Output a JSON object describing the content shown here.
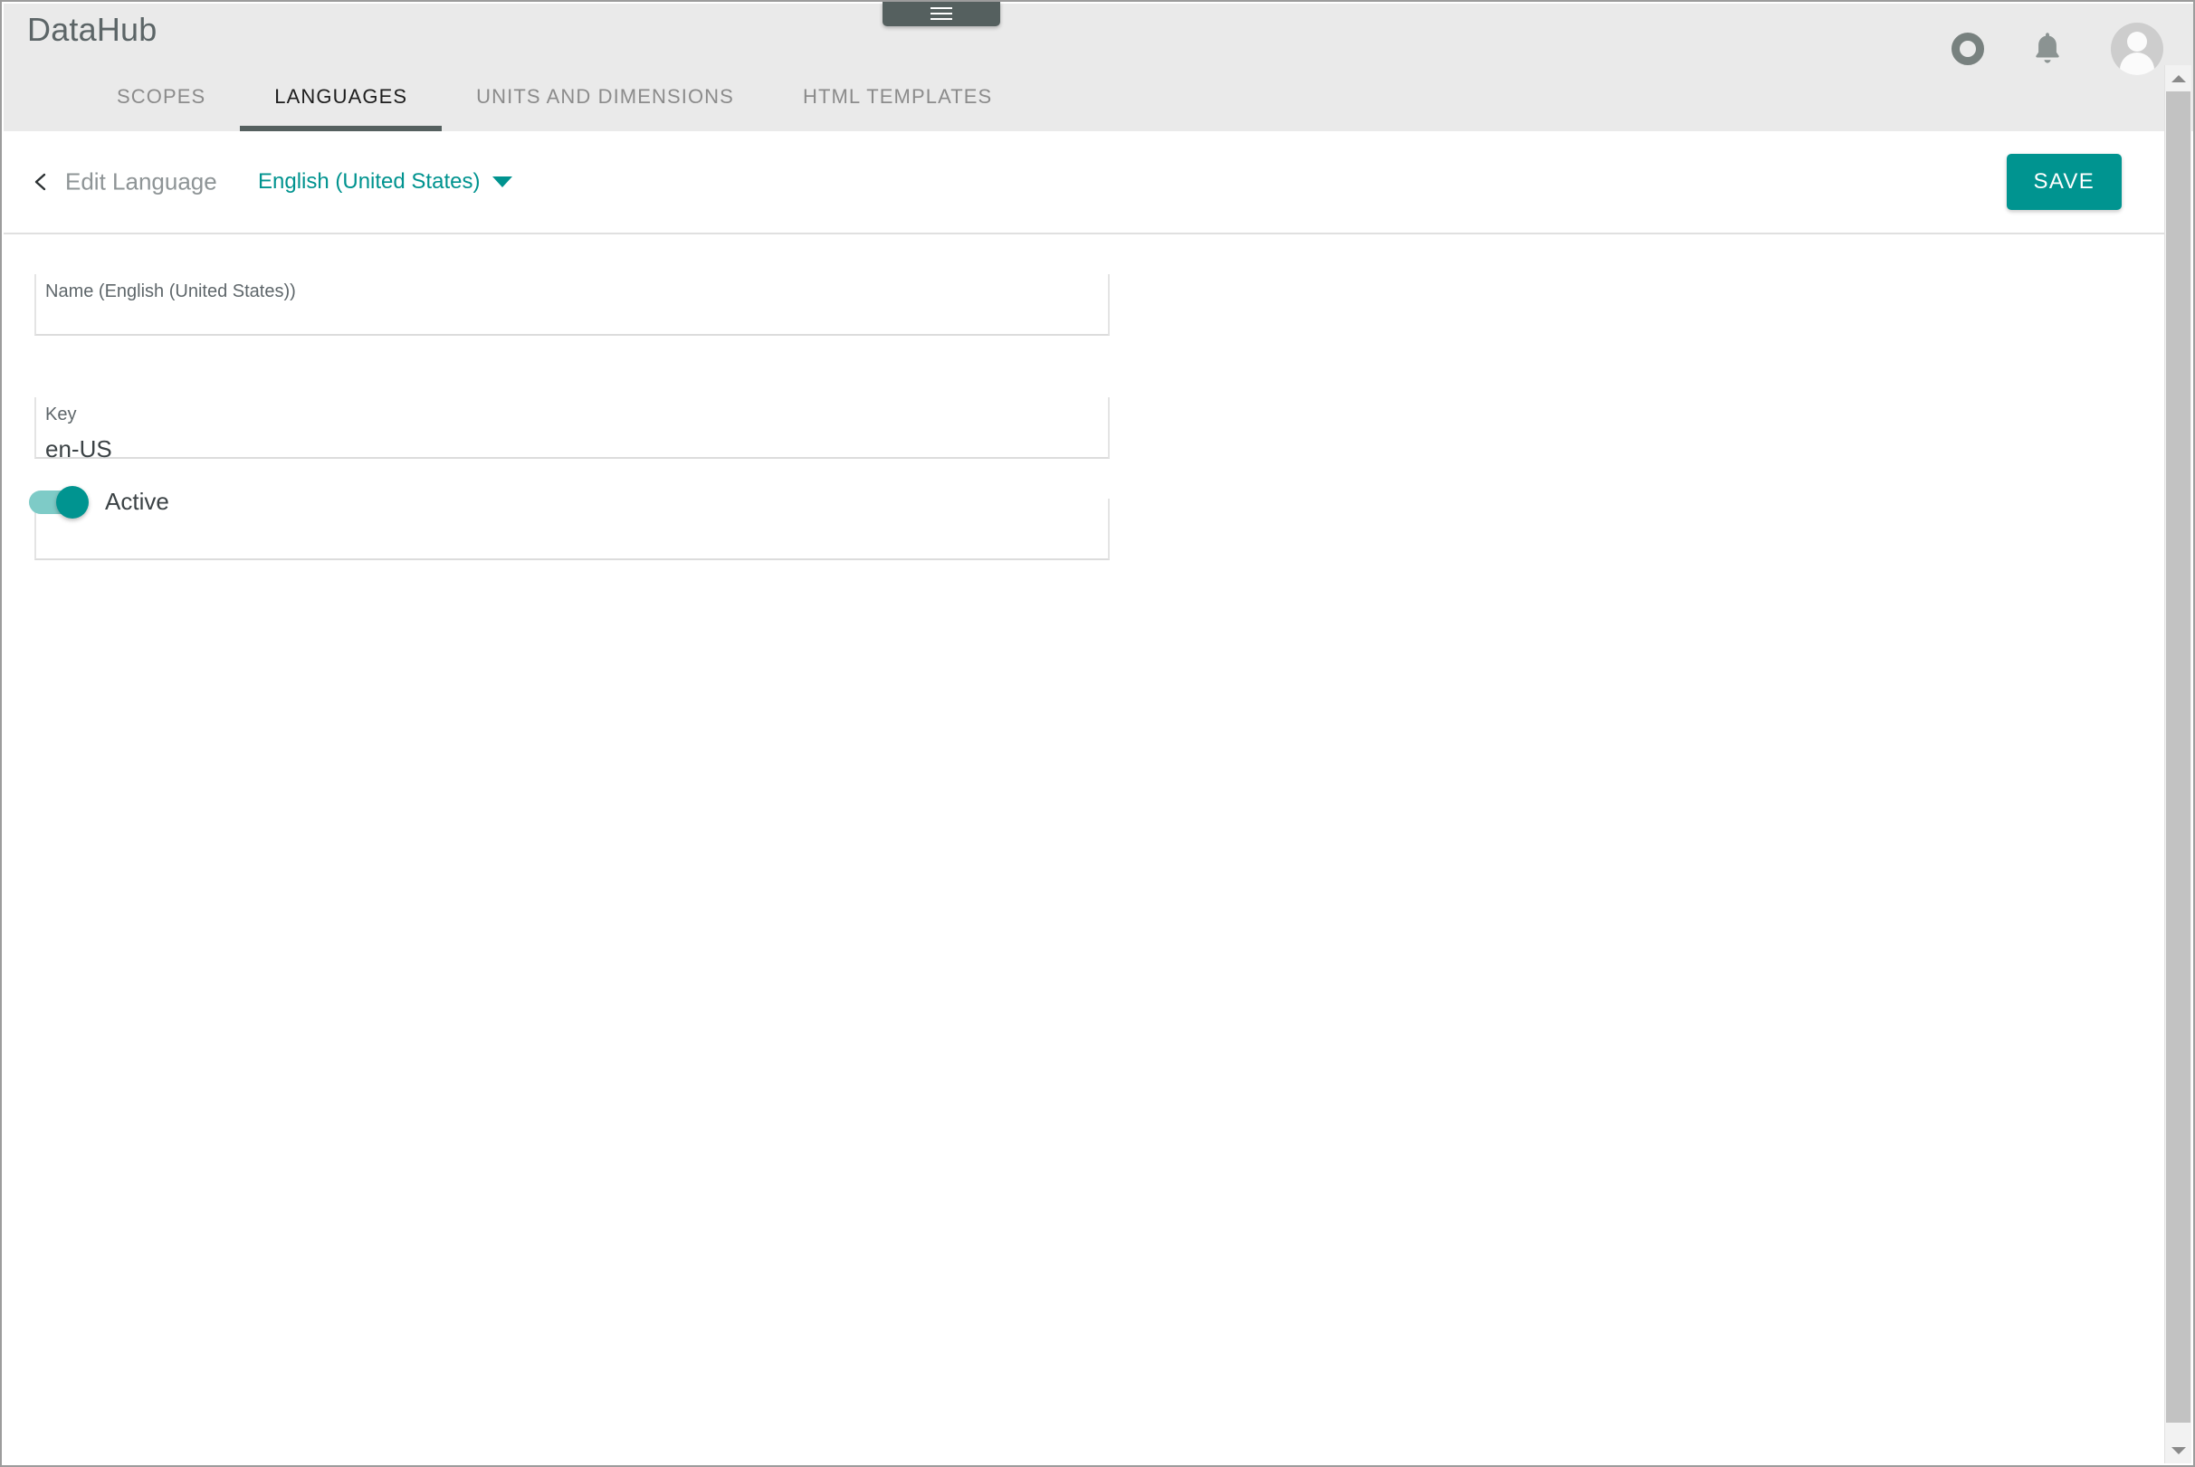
{
  "app": {
    "brand": "DataHub",
    "drag_handle_icon": "hamburger-menu-icon"
  },
  "header": {
    "icons": [
      {
        "name": "ring-icon",
        "label": ""
      },
      {
        "name": "notifications-bell-icon",
        "label": ""
      },
      {
        "name": "user-avatar",
        "label": ""
      }
    ],
    "tabs": [
      {
        "label": "SCOPES",
        "active": false
      },
      {
        "label": "LANGUAGES",
        "active": true
      },
      {
        "label": "UNITS AND DIMENSIONS",
        "active": false
      },
      {
        "label": "HTML TEMPLATES",
        "active": false
      }
    ]
  },
  "subheader": {
    "back_icon": "chevron-left-icon",
    "title": "Edit Language",
    "selected_language": "English (United States)",
    "dropdown_icon": "chevron-down-icon",
    "save_label": "SAVE"
  },
  "form": {
    "name_field": {
      "label": "Name (English (United States))",
      "value": "",
      "placeholder": ""
    },
    "key_field": {
      "label": "Key",
      "value": "en-US",
      "placeholder": ""
    },
    "active_field": {
      "label": "Active",
      "value": "on"
    }
  },
  "colors": {
    "accent": "#009490",
    "accent_light": "#7ecbc7",
    "header_bg": "#eaeaea",
    "tab_active": "#55605f",
    "text_muted": "#8e9496"
  }
}
